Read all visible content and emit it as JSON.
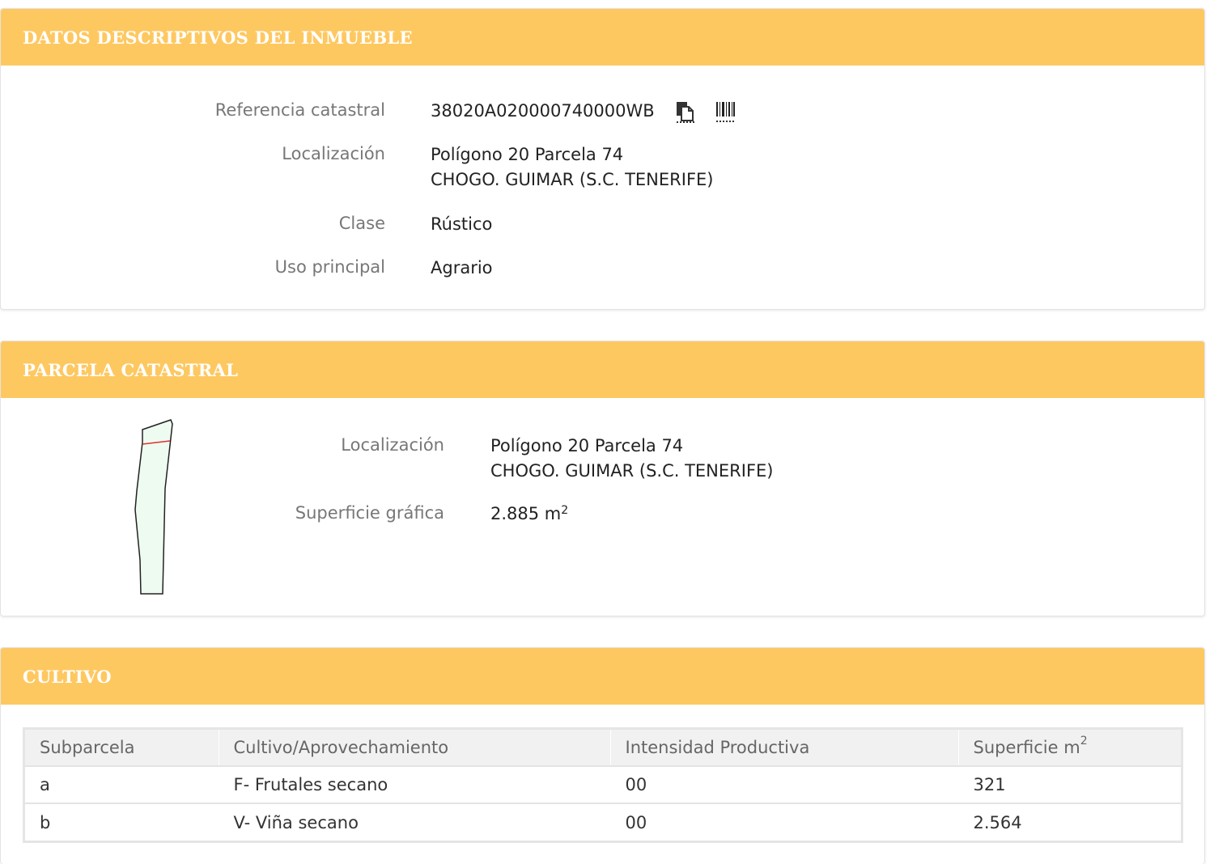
{
  "datos": {
    "header": "DATOS DESCRIPTIVOS DEL INMUEBLE",
    "ref_label": "Referencia catastral",
    "ref_value": "38020A020000740000WB",
    "loc_label": "Localización",
    "loc_line1": "Polígono 20 Parcela 74",
    "loc_line2": "CHOGO. GUIMAR (S.C. TENERIFE)",
    "clase_label": "Clase",
    "clase_value": "Rústico",
    "uso_label": "Uso principal",
    "uso_value": "Agrario"
  },
  "parcela": {
    "header": "PARCELA CATASTRAL",
    "loc_label": "Localización",
    "loc_line1": "Polígono 20 Parcela 74",
    "loc_line2": "CHOGO. GUIMAR (S.C. TENERIFE)",
    "sup_label": "Superficie gráfica",
    "sup_value": "2.885 m",
    "sup_exp": "2"
  },
  "cultivo": {
    "header": "CULTIVO",
    "columns": [
      "Subparcela",
      "Cultivo/Aprovechamiento",
      "Intensidad Productiva",
      "Superficie m"
    ],
    "sup_exp": "2",
    "rows": [
      [
        "a",
        "F- Frutales secano",
        "00",
        "321"
      ],
      [
        "b",
        "V- Viña secano",
        "00",
        "2.564"
      ]
    ]
  },
  "colors": {
    "header_bg": "#fec861",
    "header_text": "#ffffff",
    "label_text": "#777777",
    "value_text": "#222222",
    "parcel_fill": "#eefbf0",
    "parcel_line": "#e03030"
  },
  "icons": [
    "copy-icon",
    "barcode-icon"
  ]
}
